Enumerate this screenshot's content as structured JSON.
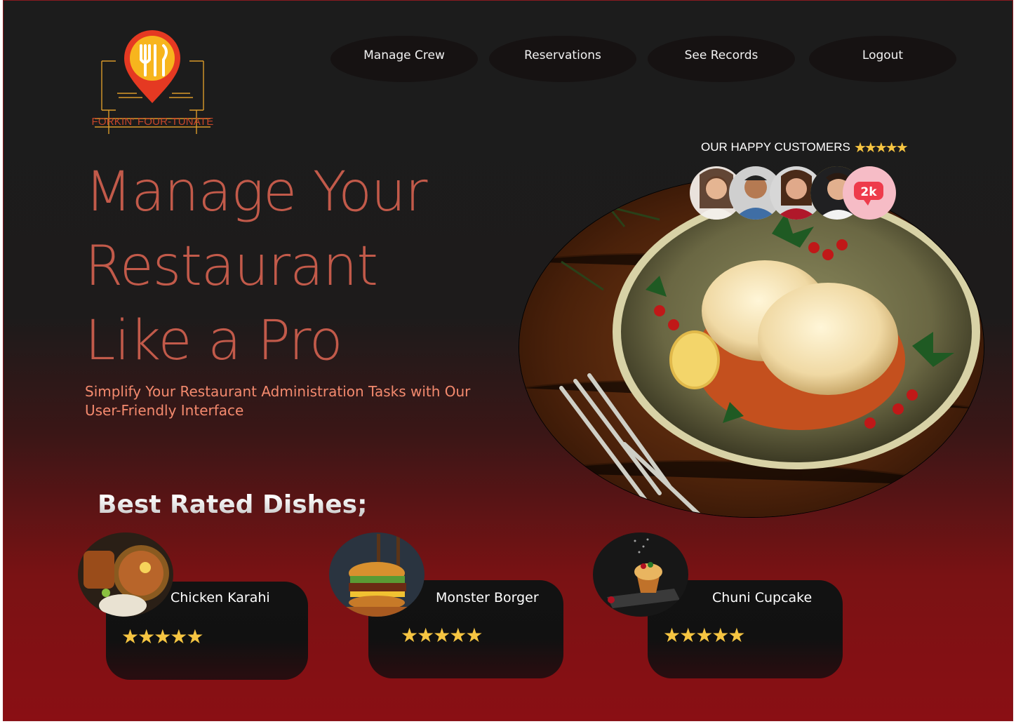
{
  "brand": {
    "name": "FORKIN' FOUR-TUNATE"
  },
  "nav": [
    {
      "label": "Manage Crew"
    },
    {
      "label": "Reservations"
    },
    {
      "label": "See Records"
    },
    {
      "label": "Logout"
    }
  ],
  "hero": {
    "title_lines": [
      "Manage Your",
      "Restaurant",
      "Like a Pro"
    ],
    "subtitle": "Simplify Your Restaurant Administration Tasks with Our User-Friendly Interface"
  },
  "customers": {
    "label": "OUR HAPPY CUSTOMERS",
    "stars": "★★★★★",
    "rating": 5,
    "count_badge": "2k"
  },
  "best": {
    "title": "Best Rated Dishes;",
    "dishes": [
      {
        "name": "Chicken Karahi",
        "stars": "★★★★★",
        "rating": 5
      },
      {
        "name": "Monster Borger",
        "stars": "★★★★★",
        "rating": 5
      },
      {
        "name": "Chuni Cupcake",
        "stars": "★★★★★",
        "rating": 5
      }
    ]
  },
  "colors": {
    "accent": "#c25a4a",
    "subtitle": "#f48a6e",
    "star": "#f6c542",
    "bottom_red": "#8a0f14"
  }
}
